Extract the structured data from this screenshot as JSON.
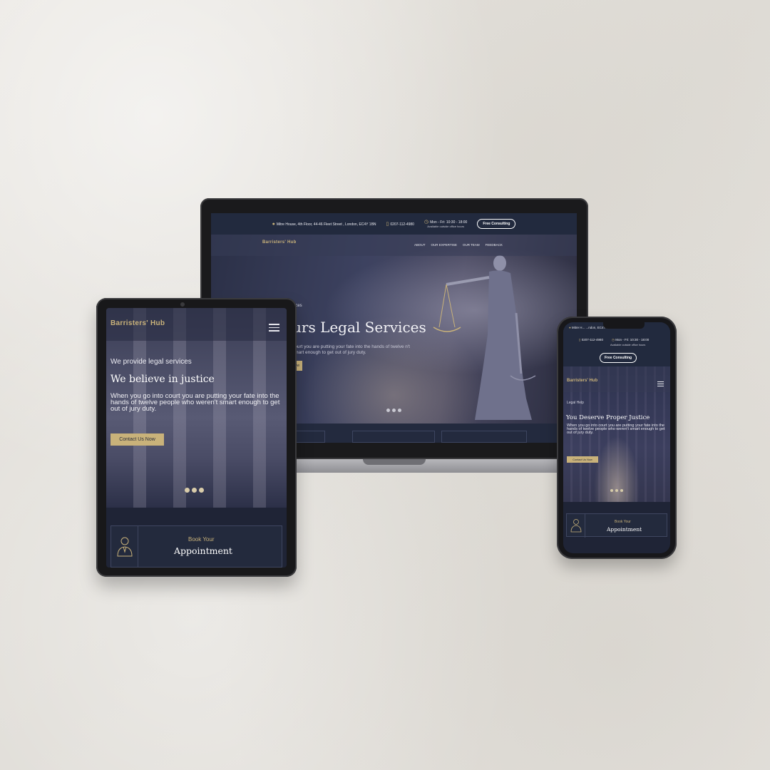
{
  "brand": {
    "name": "Barristers' Hub",
    "accent": "#c9b27a",
    "dark": "#1f2436"
  },
  "desktop": {
    "address": "Mitre House, 4th Floor, 44-46 Fleet Street , London, EC4Y 1BN",
    "phone": "0207-112-4980",
    "hours": "Mon - Fri: 10:30 - 18:00",
    "hours_note": "Available outside office hours",
    "consult_button": "Free Consulting",
    "nav": [
      "ABOUT",
      "OUR EXPERTISE",
      "OUR TEAM",
      "FEEDBACK"
    ],
    "hero_kicker": "rvices",
    "hero_title": "urs Legal Services",
    "hero_copy": "court you are putting your fate into the hands of twelve n't smart enough to get out of jury duty.",
    "hero_cta": "ow"
  },
  "tablet": {
    "kicker": "We provide legal services",
    "title": "We believe in justice",
    "copy": "When you go into court you are putting your fate into the hands of twelve people who weren't smart enough to get out of jury duty.",
    "cta": "Contact Us Now",
    "book_small": "Book Your",
    "book_large": "Appointment"
  },
  "mobile": {
    "address": "Mitre H... ...ndon, EC4Y 1BN",
    "phone": "0207-112-4980",
    "hours": "Mon - Fri: 10:30 - 18:00",
    "hours_note": "Available outside office hours",
    "consult_button": "Free Consulting",
    "kicker": "Legal Help",
    "title": "You Deserve Proper Justice",
    "copy": "When you go into court you are putting your fate into the hands of twelve people who weren't smart enough to get out of jury duty.",
    "cta": "Contact Us Now",
    "book_small": "Book Your",
    "book_large": "Appointment"
  }
}
